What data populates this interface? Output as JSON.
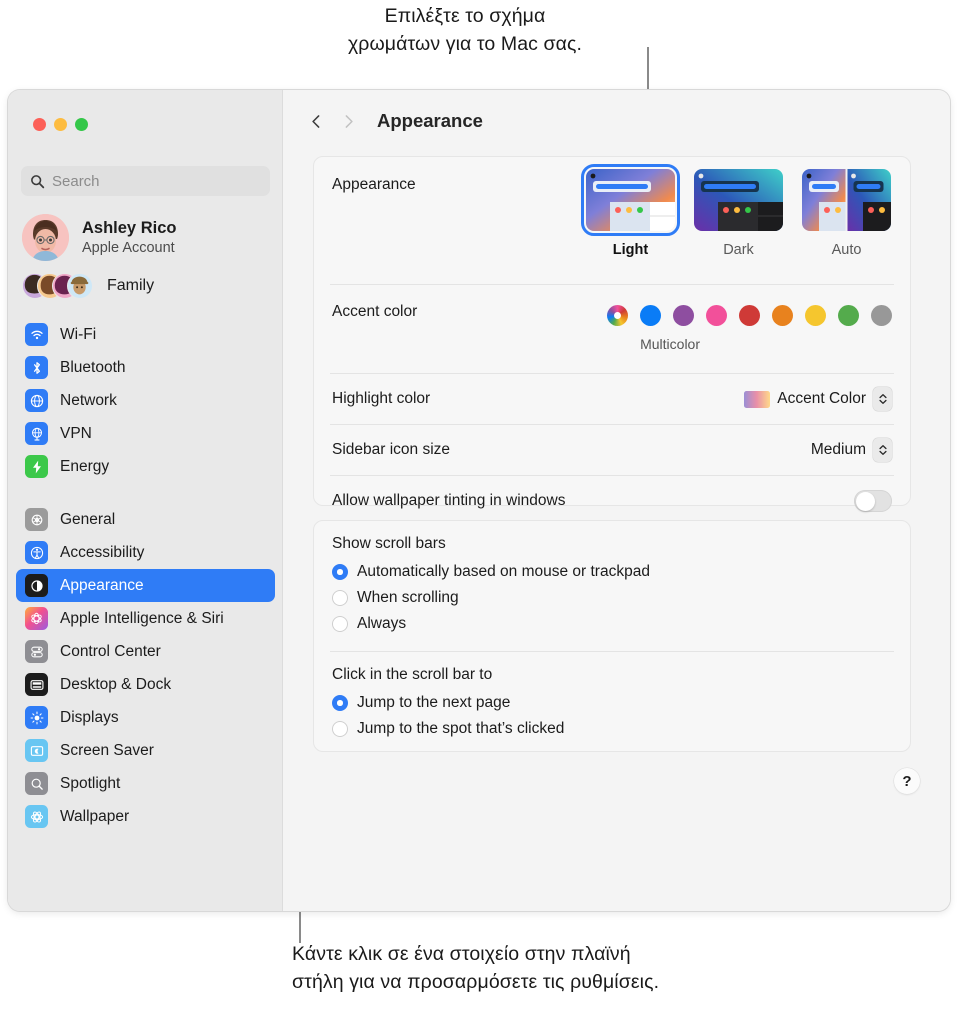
{
  "callouts": {
    "top": "Επιλέξτε το σχήμα\nχρωμάτων για το Mac σας.",
    "bottom": "Κάντε κλικ σε ένα στοιχείο στην πλαϊνή\nστήλη για να προσαρμόσετε τις ρυθμίσεις."
  },
  "window": {
    "traffic_lights": [
      "close",
      "minimize",
      "zoom"
    ]
  },
  "sidebar": {
    "search": {
      "placeholder": "Search",
      "icon": "search-icon"
    },
    "account": {
      "name": "Ashley Rico",
      "subtitle": "Apple Account"
    },
    "family": {
      "label": "Family"
    },
    "groups": [
      {
        "items": [
          {
            "label": "Wi-Fi",
            "icon": "wifi-icon",
            "color": "#2f7cf6"
          },
          {
            "label": "Bluetooth",
            "icon": "bluetooth-icon",
            "color": "#2f7cf6"
          },
          {
            "label": "Network",
            "icon": "globe-icon",
            "color": "#2f7cf6"
          },
          {
            "label": "VPN",
            "icon": "vpn-globe-icon",
            "color": "#2f7cf6"
          },
          {
            "label": "Energy",
            "icon": "bolt-icon",
            "color": "#3cc84a"
          }
        ]
      },
      {
        "items": [
          {
            "label": "General",
            "icon": "gear-icon",
            "color": "#9b9b9b"
          },
          {
            "label": "Accessibility",
            "icon": "accessibility-icon",
            "color": "#2f7cf6"
          },
          {
            "label": "Appearance",
            "icon": "appearance-icon",
            "color": "#1c1c1c",
            "selected": true
          },
          {
            "label": "Apple Intelligence & Siri",
            "icon": "siri-icon",
            "color": "#f05a9b"
          },
          {
            "label": "Control Center",
            "icon": "control-center-icon",
            "color": "#8e8e93"
          },
          {
            "label": "Desktop & Dock",
            "icon": "desktop-dock-icon",
            "color": "#1c1c1c"
          },
          {
            "label": "Displays",
            "icon": "displays-icon",
            "color": "#2f7cf6"
          },
          {
            "label": "Screen Saver",
            "icon": "screen-saver-icon",
            "color": "#68c6f2"
          },
          {
            "label": "Spotlight",
            "icon": "spotlight-icon",
            "color": "#8e8e93"
          },
          {
            "label": "Wallpaper",
            "icon": "wallpaper-icon",
            "color": "#68c6f2"
          }
        ]
      }
    ]
  },
  "toolbar": {
    "back_icon": "chevron-left-icon",
    "forward_icon": "chevron-right-icon",
    "title": "Appearance"
  },
  "main": {
    "appearance": {
      "label": "Appearance",
      "options": [
        {
          "label": "Light",
          "selected": true
        },
        {
          "label": "Dark",
          "selected": false
        },
        {
          "label": "Auto",
          "selected": false
        }
      ]
    },
    "accent_color": {
      "label": "Accent color",
      "selected_label": "Multicolor",
      "swatches": [
        {
          "name": "multicolor",
          "color": "multicolor"
        },
        {
          "name": "blue",
          "color": "#0a7cf6"
        },
        {
          "name": "purple",
          "color": "#8e4ea0"
        },
        {
          "name": "pink",
          "color": "#f2509a"
        },
        {
          "name": "red",
          "color": "#cf3a37"
        },
        {
          "name": "orange",
          "color": "#e8821e"
        },
        {
          "name": "yellow",
          "color": "#f5c62e"
        },
        {
          "name": "green",
          "color": "#54ab4c"
        },
        {
          "name": "graphite",
          "color": "#989898"
        }
      ]
    },
    "highlight_color": {
      "label": "Highlight color",
      "value": "Accent Color"
    },
    "sidebar_icon_size": {
      "label": "Sidebar icon size",
      "value": "Medium"
    },
    "wallpaper_tinting": {
      "label": "Allow wallpaper tinting in windows",
      "enabled": false
    },
    "show_scroll_bars": {
      "label": "Show scroll bars",
      "options": [
        {
          "label": "Automatically based on mouse or trackpad",
          "selected": true
        },
        {
          "label": "When scrolling",
          "selected": false
        },
        {
          "label": "Always",
          "selected": false
        }
      ]
    },
    "click_scroll_bar": {
      "label": "Click in the scroll bar to",
      "options": [
        {
          "label": "Jump to the next page",
          "selected": true
        },
        {
          "label": "Jump to the spot that’s clicked",
          "selected": false
        }
      ]
    },
    "help": {
      "label": "?"
    }
  },
  "colors": {
    "accent": "#2f7cf6",
    "selection": "#2f7cf6"
  }
}
